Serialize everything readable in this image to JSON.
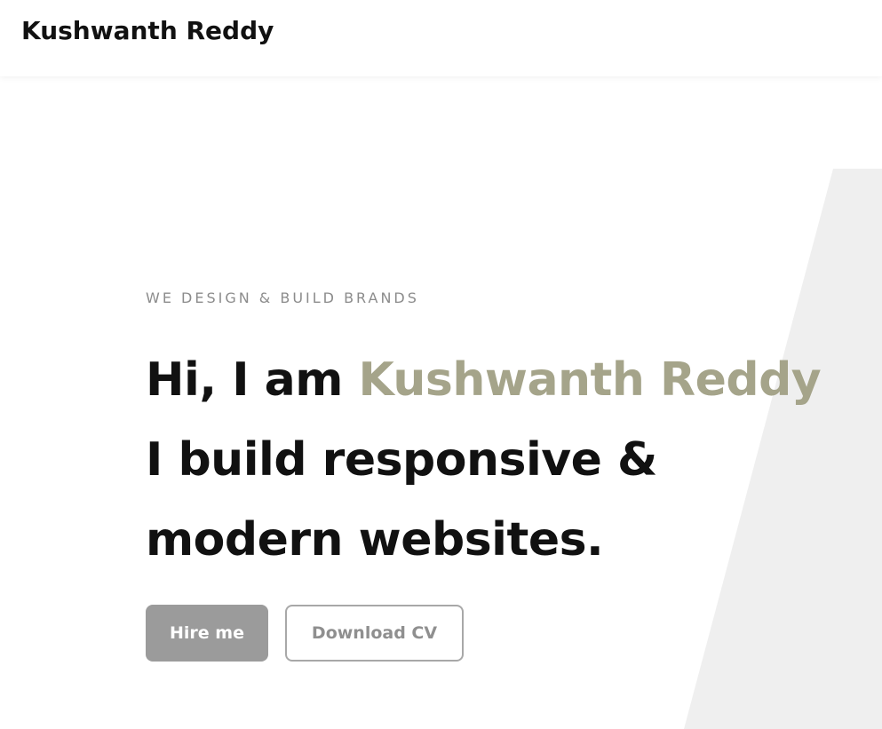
{
  "navbar": {
    "brand": "Kushwanth Reddy"
  },
  "hero": {
    "eyebrow": "WE DESIGN & BUILD BRANDS",
    "headline": {
      "prefix": "Hi, I am ",
      "name": "Kushwanth Reddy",
      "line2": "I build responsive &",
      "line3": "modern websites."
    },
    "buttons": {
      "hire_label": "Hire me",
      "cv_label": "Download CV"
    }
  },
  "colors": {
    "accent": "#a5a48a",
    "primary_button": "#9b9b9b",
    "background_shape": "#efefef",
    "text_dark": "#111111",
    "text_muted": "#8c8c8c"
  }
}
